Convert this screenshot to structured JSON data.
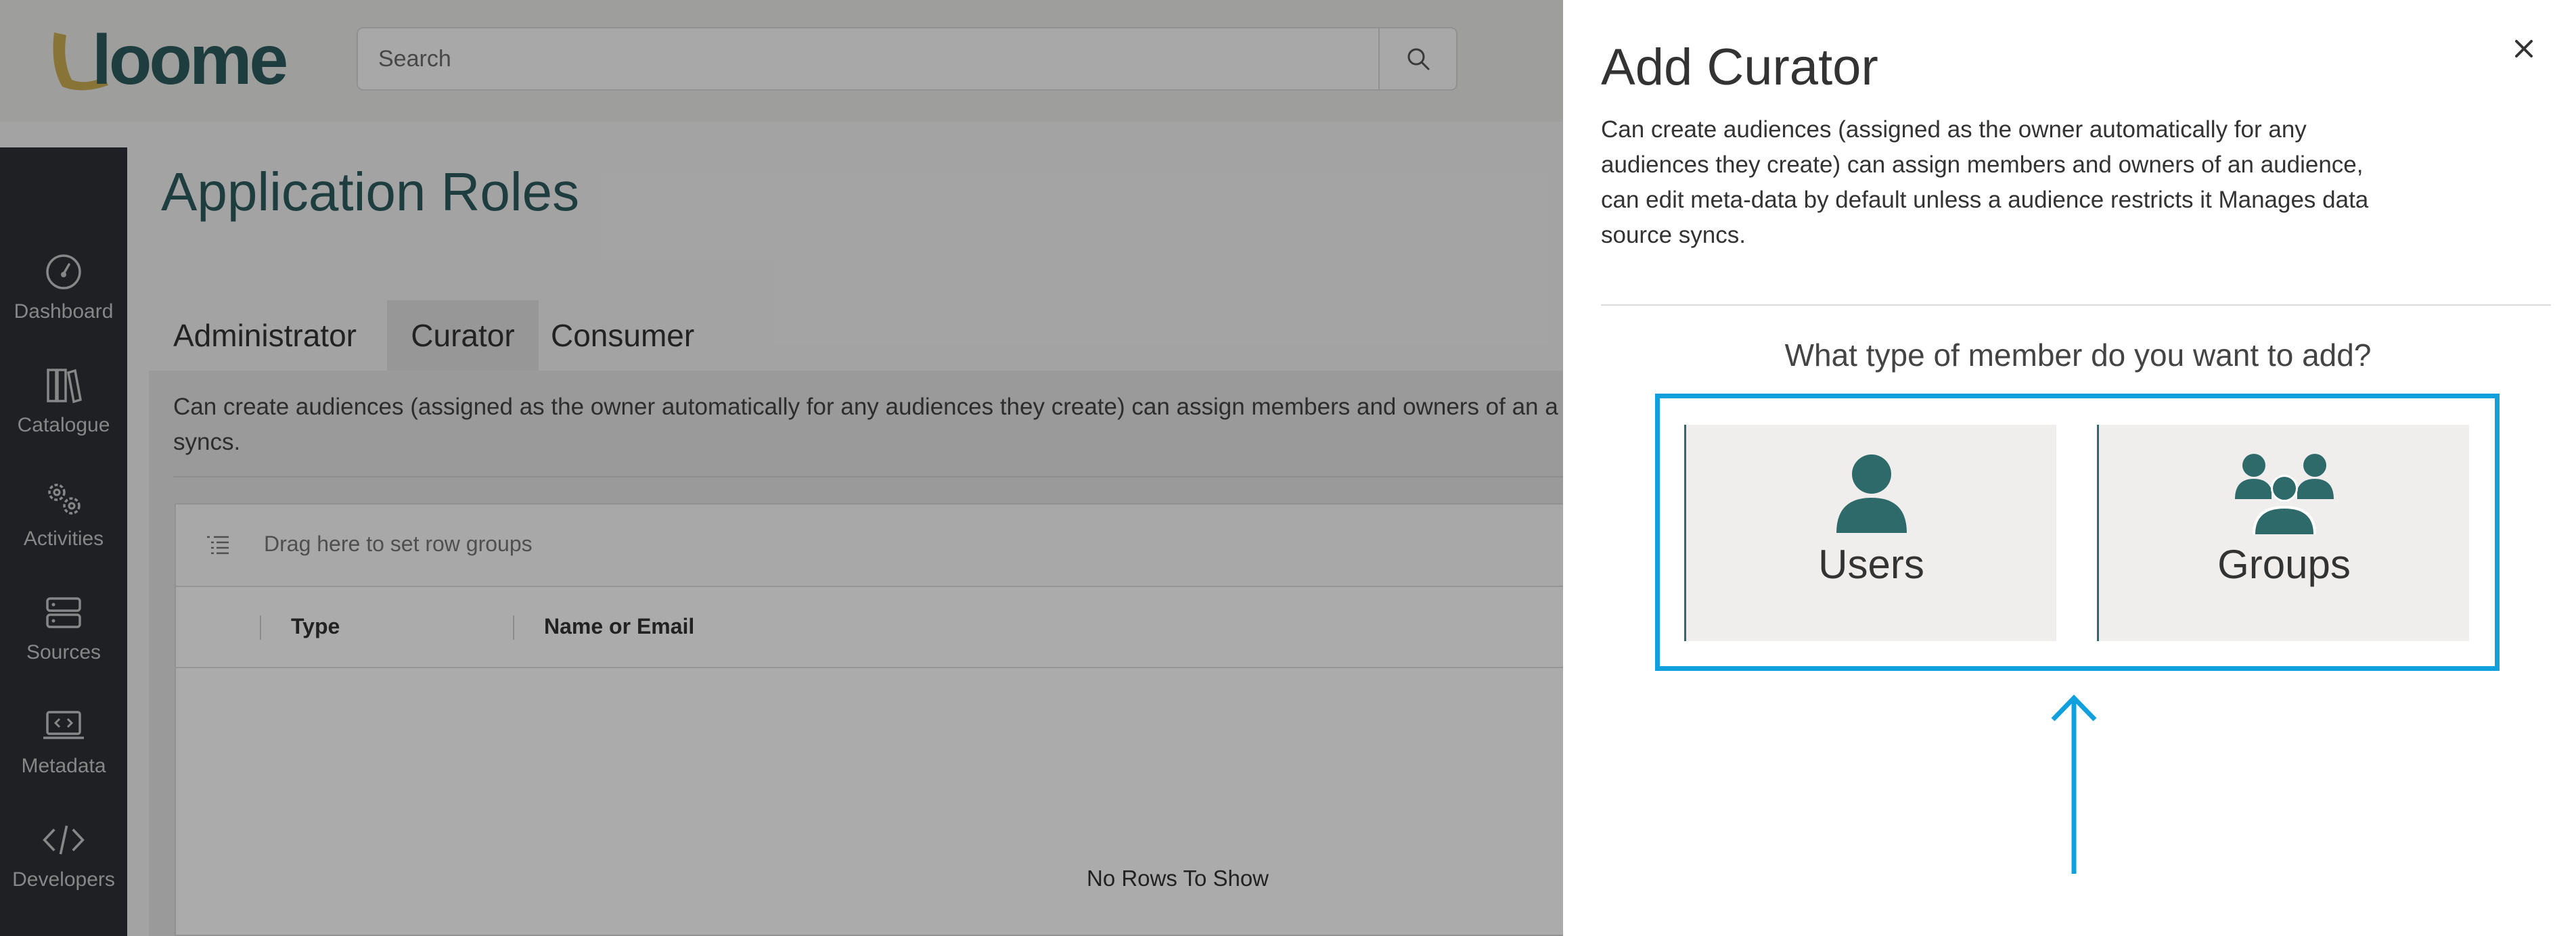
{
  "header": {
    "logo_text": "loome",
    "search": {
      "placeholder": "Search",
      "value": ""
    }
  },
  "sidebar": {
    "items": [
      {
        "label": "Dashboard",
        "icon": "dashboard-gauge-icon"
      },
      {
        "label": "Catalogue",
        "icon": "catalogue-books-icon"
      },
      {
        "label": "Activities",
        "icon": "activities-gears-icon"
      },
      {
        "label": "Sources",
        "icon": "sources-server-icon"
      },
      {
        "label": "Metadata",
        "icon": "metadata-laptop-code-icon"
      },
      {
        "label": "Developers",
        "icon": "developers-code-icon"
      }
    ]
  },
  "page": {
    "title": "Application Roles",
    "tabs": [
      "Administrator",
      "Curator",
      "Consumer"
    ],
    "active_tab": "Curator",
    "role_description": "Can create audiences (assigned as the owner automatically for any audiences they create) can assign members and owners of an a",
    "role_description_line2": "syncs.",
    "grid": {
      "toolbar_text": "Drag here to set row groups",
      "columns": [
        "Type",
        "Name or Email"
      ],
      "empty_text": "No Rows To Show"
    }
  },
  "modal": {
    "title": "Add Curator",
    "description": "Can create audiences (assigned as the owner automatically for any audiences they create) can assign members and owners of an audience, can edit meta-data by default unless a audience restricts it Manages data source syncs.",
    "question": "What type of member do you want to add?",
    "choices": [
      {
        "label": "Users",
        "icon": "user-icon"
      },
      {
        "label": "Groups",
        "icon": "group-icon"
      }
    ],
    "close_label": "×"
  },
  "colors": {
    "accent_teal": "#2e6a6a",
    "highlight_blue": "#0fa0dd",
    "sidebar_bg": "#2d3035"
  }
}
